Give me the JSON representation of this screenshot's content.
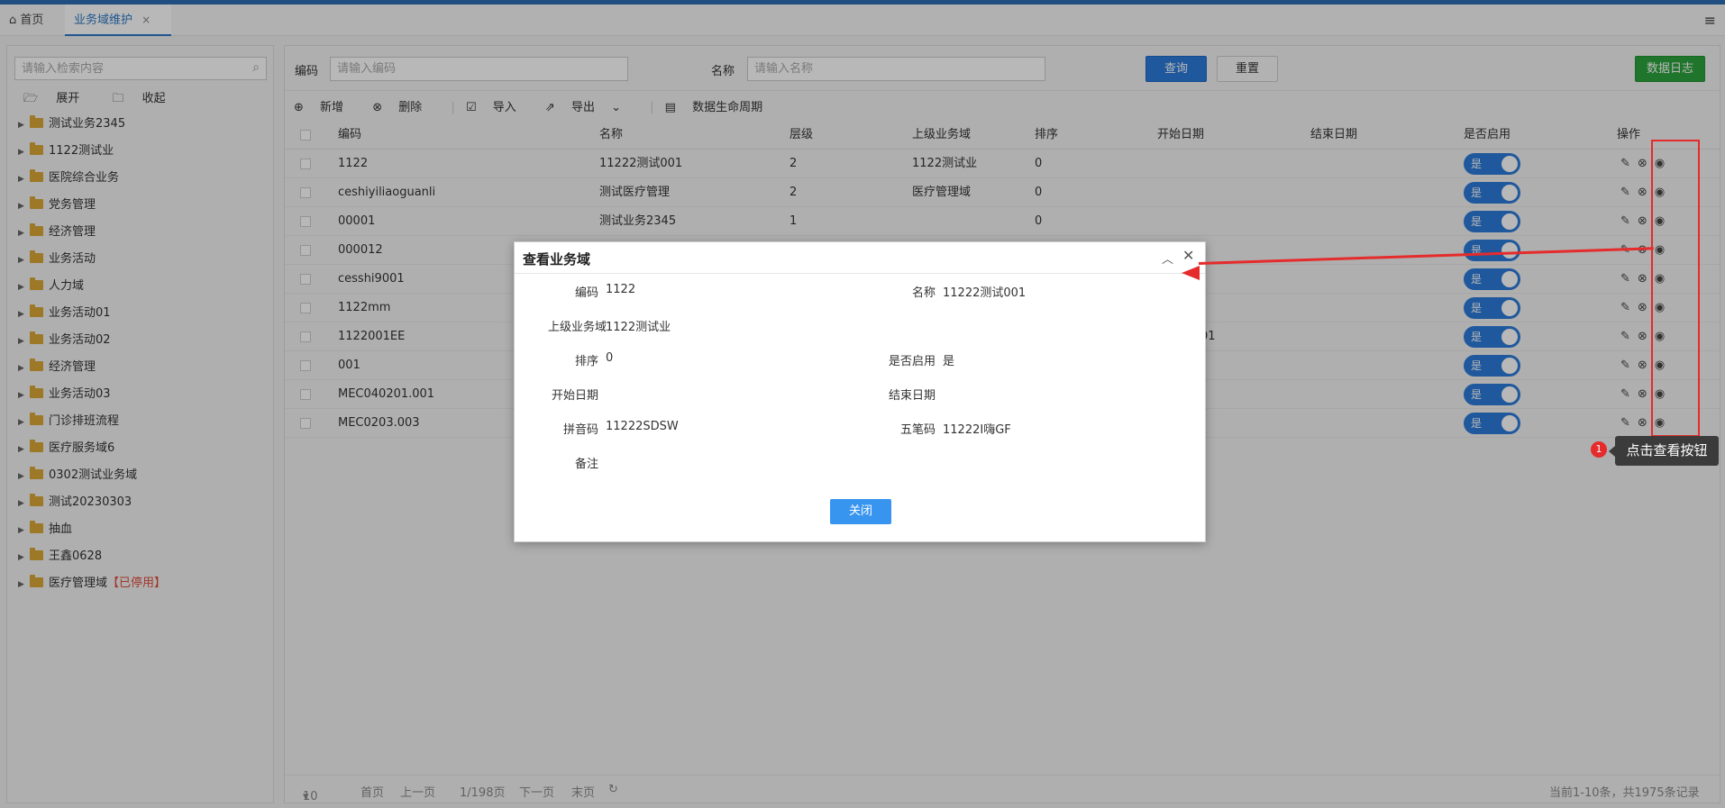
{
  "tabs": {
    "home_label": "首页",
    "active_label": "业务域维护",
    "close_glyph": "×",
    "menu_glyph": "≡"
  },
  "sidebar": {
    "search_placeholder": "请输入检索内容",
    "expand_label": "展开",
    "collapse_label": "收起",
    "items": [
      {
        "label": "测试业务2345"
      },
      {
        "label": "1122测试业"
      },
      {
        "label": "医院综合业务"
      },
      {
        "label": "党务管理"
      },
      {
        "label": "经济管理"
      },
      {
        "label": "业务活动"
      },
      {
        "label": "人力域"
      },
      {
        "label": "业务活动01"
      },
      {
        "label": "业务活动02"
      },
      {
        "label": "经济管理"
      },
      {
        "label": "业务活动03"
      },
      {
        "label": "门诊排班流程"
      },
      {
        "label": "医疗服务域6"
      },
      {
        "label": "0302测试业务域"
      },
      {
        "label": "测试20230303"
      },
      {
        "label": "抽血"
      },
      {
        "label": "王鑫0628"
      },
      {
        "label": "医疗管理域",
        "status": "【已停用】"
      }
    ]
  },
  "filter": {
    "code_label": "编码",
    "code_placeholder": "请输入编码",
    "name_label": "名称",
    "name_placeholder": "请输入名称",
    "query_button": "查询",
    "reset_button": "重置",
    "log_button": "数据日志"
  },
  "toolbar": {
    "add": "新增",
    "delete": "删除",
    "import": "导入",
    "export": "导出",
    "lifecycle": "数据生命周期"
  },
  "table": {
    "headers": [
      "编码",
      "名称",
      "层级",
      "上级业务域",
      "排序",
      "开始日期",
      "结束日期",
      "是否启用",
      "操作"
    ],
    "rows": [
      {
        "code": "1122",
        "name": "11222测试001",
        "level": "2",
        "parent": "1122测试业",
        "sort": "0",
        "start": "",
        "enabled": "是"
      },
      {
        "code": "ceshiyiliaoguanli",
        "name": "测试医疗管理",
        "level": "2",
        "parent": "医疗管理域",
        "sort": "0",
        "start": "",
        "enabled": "是"
      },
      {
        "code": "00001",
        "name": "测试业务2345",
        "level": "1",
        "parent": "",
        "sort": "0",
        "start": "",
        "enabled": "是"
      },
      {
        "code": "000012",
        "name": "",
        "level": "",
        "parent": "",
        "sort": "",
        "start": "",
        "enabled": "是"
      },
      {
        "code": "cesshi9001",
        "name": "",
        "level": "",
        "parent": "",
        "sort": "",
        "start": "",
        "enabled": "是"
      },
      {
        "code": "1122mm",
        "name": "",
        "level": "",
        "parent": "",
        "sort": "",
        "start": "",
        "enabled": "是"
      },
      {
        "code": "1122001EE",
        "name": "",
        "level": "",
        "parent": "",
        "sort": "",
        "start": "01",
        "enabled": "是"
      },
      {
        "code": "001",
        "name": "",
        "level": "",
        "parent": "",
        "sort": "",
        "start": "",
        "enabled": "是"
      },
      {
        "code": "MEC040201.001",
        "name": "",
        "level": "",
        "parent": "",
        "sort": "",
        "start": "",
        "enabled": "是"
      },
      {
        "code": "MEC0203.003",
        "name": "",
        "level": "",
        "parent": "",
        "sort": "",
        "start": "",
        "enabled": "是"
      }
    ]
  },
  "pager": {
    "size": "10",
    "first": "首页",
    "prev": "上一页",
    "page_info": "1/198页",
    "next": "下一页",
    "last": "末页",
    "summary": "当前1-10条，共1975条记录"
  },
  "annotation": {
    "badge": "1",
    "tip": "点击查看按钮",
    "color": "#e52b2b"
  },
  "modal": {
    "title": "查看业务域",
    "code_label": "编码",
    "code_value": "1122",
    "name_label": "名称",
    "name_value": "11222测试001",
    "parent_label": "上级业务域",
    "parent_value": "1122测试业",
    "sort_label": "排序",
    "sort_value": "0",
    "enabled_label": "是否启用",
    "enabled_value": "是",
    "start_label": "开始日期",
    "start_value": "",
    "end_label": "结束日期",
    "end_value": "",
    "pinyin_label": "拼音码",
    "pinyin_value": "11222SDSW",
    "wubi_label": "五笔码",
    "wubi_value": "11222I嗨GF",
    "remark_label": "备注",
    "remark_value": "",
    "close_button": "关闭"
  },
  "colors": {
    "accent": "#2b7ad8",
    "green": "#2ca23c",
    "highlight": "#e52b2b"
  }
}
